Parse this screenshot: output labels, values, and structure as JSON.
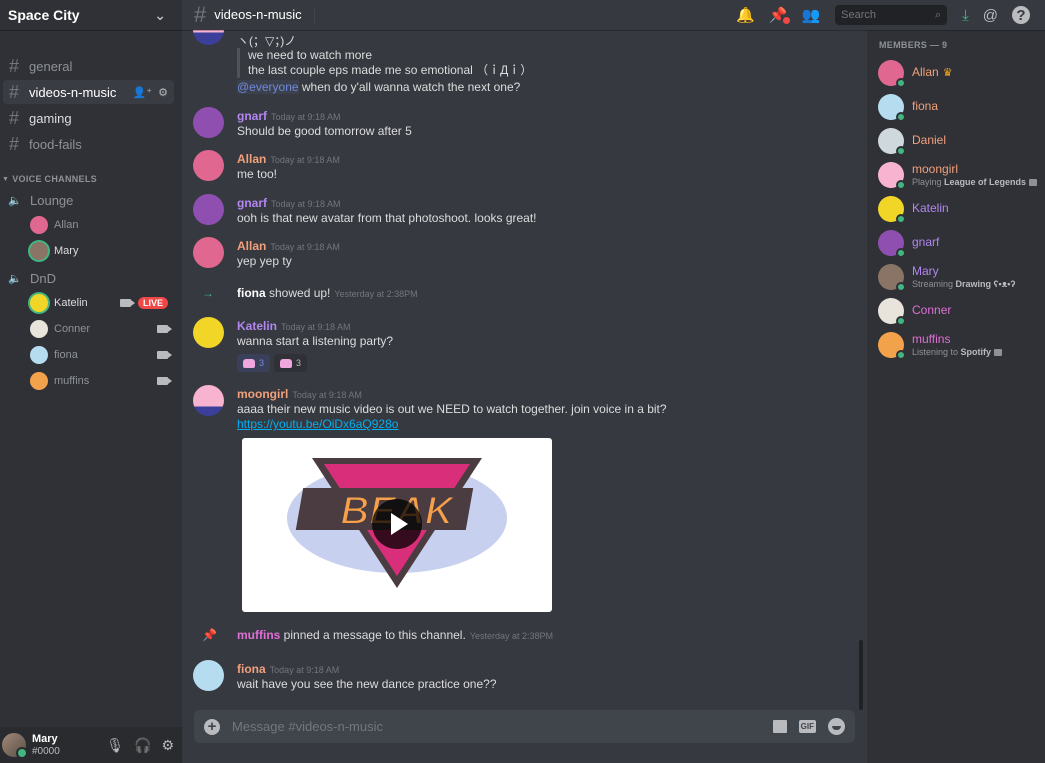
{
  "server": {
    "name": "Space City"
  },
  "text_channels": [
    {
      "name": "general",
      "state": "muted"
    },
    {
      "name": "videos-n-music",
      "state": "active"
    },
    {
      "name": "gaming",
      "state": "unread"
    },
    {
      "name": "food-fails",
      "state": "muted"
    }
  ],
  "voice_category": "VOICE CHANNELS",
  "voice_channels": [
    {
      "name": "Lounge",
      "users": [
        {
          "name": "Allan",
          "color": "#e0678f",
          "speaking": false
        },
        {
          "name": "Mary",
          "color": "#8a7466",
          "speaking": true
        }
      ]
    },
    {
      "name": "DnD",
      "users": [
        {
          "name": "Katelin",
          "color": "#f1d628",
          "speaking": true,
          "video": true,
          "live": "LIVE"
        },
        {
          "name": "Conner",
          "color": "#e8e4dc",
          "speaking": false,
          "video": true
        },
        {
          "name": "fiona",
          "color": "#b6dcf0",
          "speaking": false,
          "video": true
        },
        {
          "name": "muffins",
          "color": "#f3a24c",
          "speaking": false,
          "video": true
        }
      ]
    }
  ],
  "user_panel": {
    "name": "Mary",
    "tag": "#0000"
  },
  "topbar": {
    "channel": "videos-n-music",
    "search_placeholder": "Search"
  },
  "messages": [
    {
      "type": "continuation",
      "lines": [
        "ヽ(；▽；)ノ"
      ],
      "quote": [
        "we need to watch more",
        "the last couple eps made me so emotional （ｉДｉ）"
      ],
      "mention": "@everyone",
      "mention_rest": " when do y'all wanna watch the next one?"
    },
    {
      "author": "gnarf",
      "color": "#b386f0",
      "time": "Today at 9:18 AM",
      "text": "Should be good tomorrow after 5"
    },
    {
      "author": "Allan",
      "color": "#f2a07b",
      "time": "Today at 9:18 AM",
      "text": "me too!"
    },
    {
      "author": "gnarf",
      "color": "#b386f0",
      "time": "Today at 9:18 AM",
      "text": "ooh is that new avatar from that photoshoot. looks great!"
    },
    {
      "author": "Allan",
      "color": "#f2a07b",
      "time": "Today at 9:18 AM",
      "text": "yep yep ty"
    },
    {
      "type": "join",
      "who": "fiona",
      "text": " showed up!",
      "time": "Yesterday at 2:38PM"
    },
    {
      "author": "Katelin",
      "color": "#b386f0",
      "time": "Today at 9:18 AM",
      "text": "wanna start a listening party?",
      "reactions": [
        {
          "count": "3",
          "me": true
        },
        {
          "count": "3",
          "me": false
        }
      ]
    },
    {
      "author": "moongirl",
      "color": "#f2a07b",
      "time": "Today at 9:18 AM",
      "text": "aaaa their new music video is out we NEED to watch together. join voice in a bit?",
      "link": "https://youtu.be/OiDx6aQ928o",
      "embed_title": "BEAK"
    },
    {
      "type": "pin",
      "who": "muffins",
      "who_color": "#e06fd6",
      "text": " pinned a message to this channel.",
      "time": "Yesterday at 2:38PM"
    },
    {
      "author": "fiona",
      "color": "#f2a07b",
      "time": "Today at 9:18 AM",
      "text": "wait have you see the new dance practice one??"
    }
  ],
  "composer": {
    "placeholder": "Message #videos-n-music",
    "gif_label": "GIF"
  },
  "members": {
    "header": "MEMBERS — 9",
    "list": [
      {
        "name": "Allan",
        "color": "#f2a07b",
        "owner": true,
        "avatar": "#e0678f"
      },
      {
        "name": "fiona",
        "color": "#f2a07b",
        "avatar": "#b6dcf0"
      },
      {
        "name": "Daniel",
        "color": "#f2a07b",
        "avatar": "#cfd8dc"
      },
      {
        "name": "moongirl",
        "color": "#f2a07b",
        "avatar": "#f7b3d0",
        "activity_prefix": "Playing ",
        "activity": "League of Legends",
        "rich": true
      },
      {
        "name": "Katelin",
        "color": "#b386f0",
        "avatar": "#f1d628"
      },
      {
        "name": "gnarf",
        "color": "#b386f0",
        "avatar": "#8e4fb0"
      },
      {
        "name": "Mary",
        "color": "#b386f0",
        "avatar": "#8a7466",
        "activity_prefix": "Streaming ",
        "activity": "Drawing ʕ•ᴥ•ʔ"
      },
      {
        "name": "Conner",
        "color": "#e06fd6",
        "avatar": "#e8e4dc"
      },
      {
        "name": "muffins",
        "color": "#e06fd6",
        "avatar": "#f3a24c",
        "activity_prefix": "Listening to ",
        "activity": "Spotify",
        "rich": true
      }
    ]
  }
}
